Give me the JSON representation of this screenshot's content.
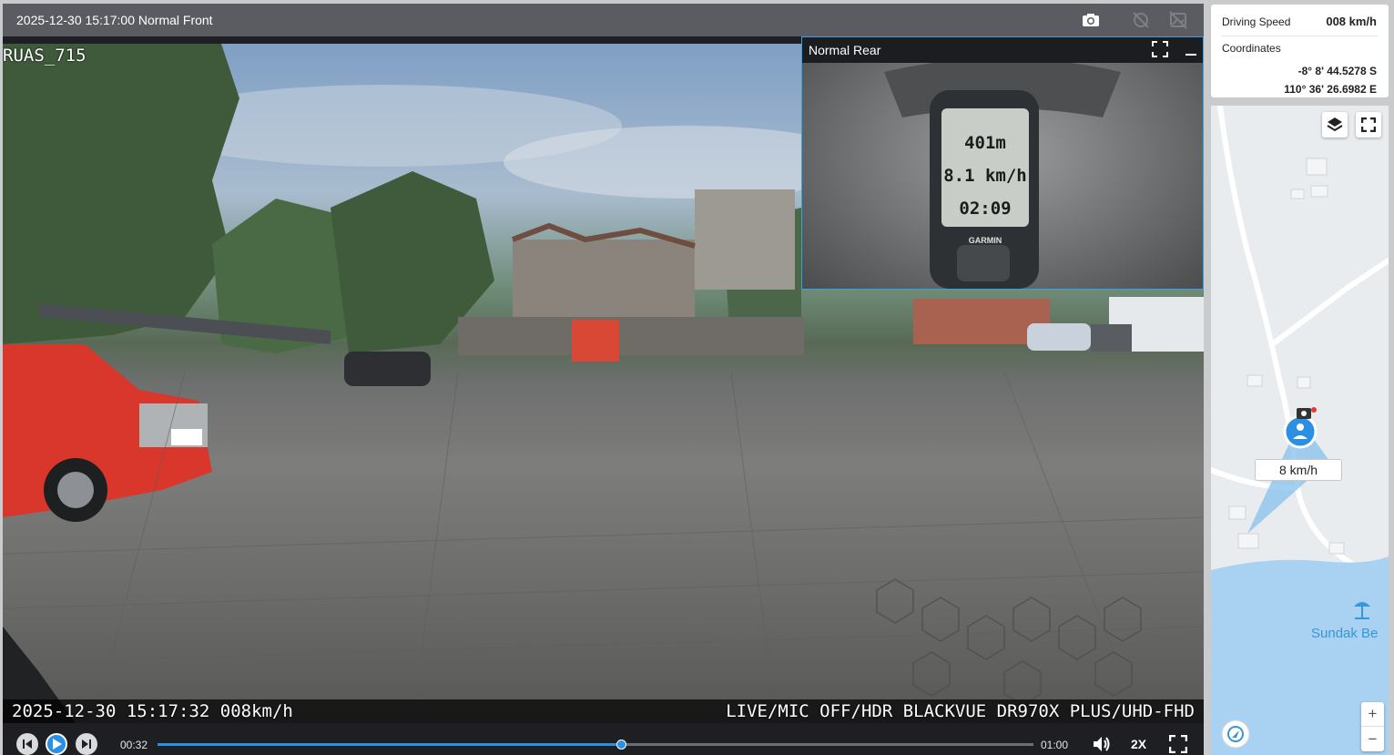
{
  "player": {
    "title": "2025-12-30 15:17:00 Normal Front",
    "front_overlay_name": "RUAS_715",
    "caption_left": "2025-12-30 15:17:32 008km/h",
    "caption_right": "LIVE/MIC OFF/HDR BLACKVUE DR970X PLUS/UHD-FHD",
    "rear_title": "Normal Rear",
    "rear_device_readings": [
      "401m",
      "8.1 km/h",
      "02:09"
    ],
    "rear_device_brand": "GARMIN",
    "controls": {
      "time_current": "00:32",
      "time_total": "01:00",
      "progress": 0.53,
      "playback_speed": "2X"
    },
    "icons": [
      "snapshot-icon",
      "pin-off-icon",
      "gallery-off-icon",
      "expand-icon",
      "minimize-icon",
      "prev-icon",
      "play-icon",
      "next-icon",
      "volume-icon",
      "fullscreen-icon"
    ]
  },
  "info": {
    "speed_label": "Driving Speed",
    "speed_value": "008 km/h",
    "coords_label": "Coordinates",
    "lat": "-8° 8' 44.5278 S",
    "lon": "110° 36' 26.6982 E"
  },
  "map": {
    "speed_chip": "8 km/h",
    "place_label": "Sundak Be",
    "zoom_in": "+",
    "zoom_out": "−",
    "water_color": "#a9d2f2",
    "road_color": "#ffffff",
    "accent": "#2b8fe3"
  }
}
